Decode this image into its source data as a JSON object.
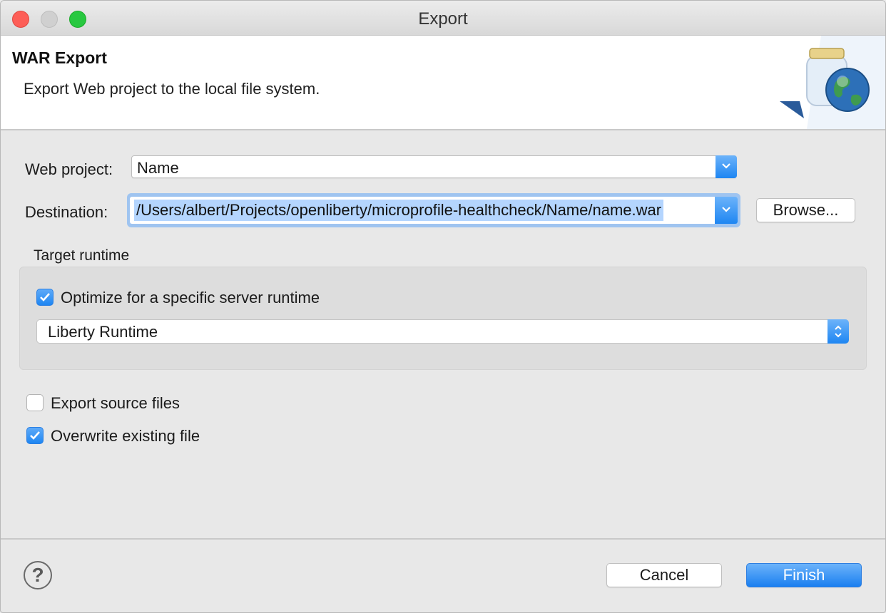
{
  "window": {
    "title": "Export"
  },
  "banner": {
    "title": "WAR Export",
    "description": "Export Web project to the local file system."
  },
  "form": {
    "web_project_label": "Web project:",
    "web_project_value": "Name",
    "destination_label": "Destination:",
    "destination_value": "/Users/albert/Projects/openliberty/microprofile-healthcheck/Name/name.war",
    "browse_label": "Browse...",
    "target_runtime": {
      "group_label": "Target runtime",
      "optimize_label": "Optimize for a specific server runtime",
      "optimize_checked": true,
      "runtime_value": "Liberty Runtime"
    },
    "export_source_label": "Export source files",
    "export_source_checked": false,
    "overwrite_label": "Overwrite existing file",
    "overwrite_checked": true
  },
  "footer": {
    "help_glyph": "?",
    "cancel_label": "Cancel",
    "finish_label": "Finish"
  },
  "icons": {
    "close": "close-icon",
    "minimize": "minimize-icon",
    "zoom": "zoom-icon",
    "wizard_banner": "jar-globe-icon",
    "dropdown": "chevron-down-icon",
    "stepper": "up-down-chevron-icon",
    "check": "checkmark-icon",
    "help": "help-icon"
  },
  "colors": {
    "accent": "#1e86f2",
    "close_button": "#fd5e57",
    "zoom_button": "#28c840",
    "selection": "#b4d5fe",
    "focus_ring": "#9fc4f0"
  }
}
